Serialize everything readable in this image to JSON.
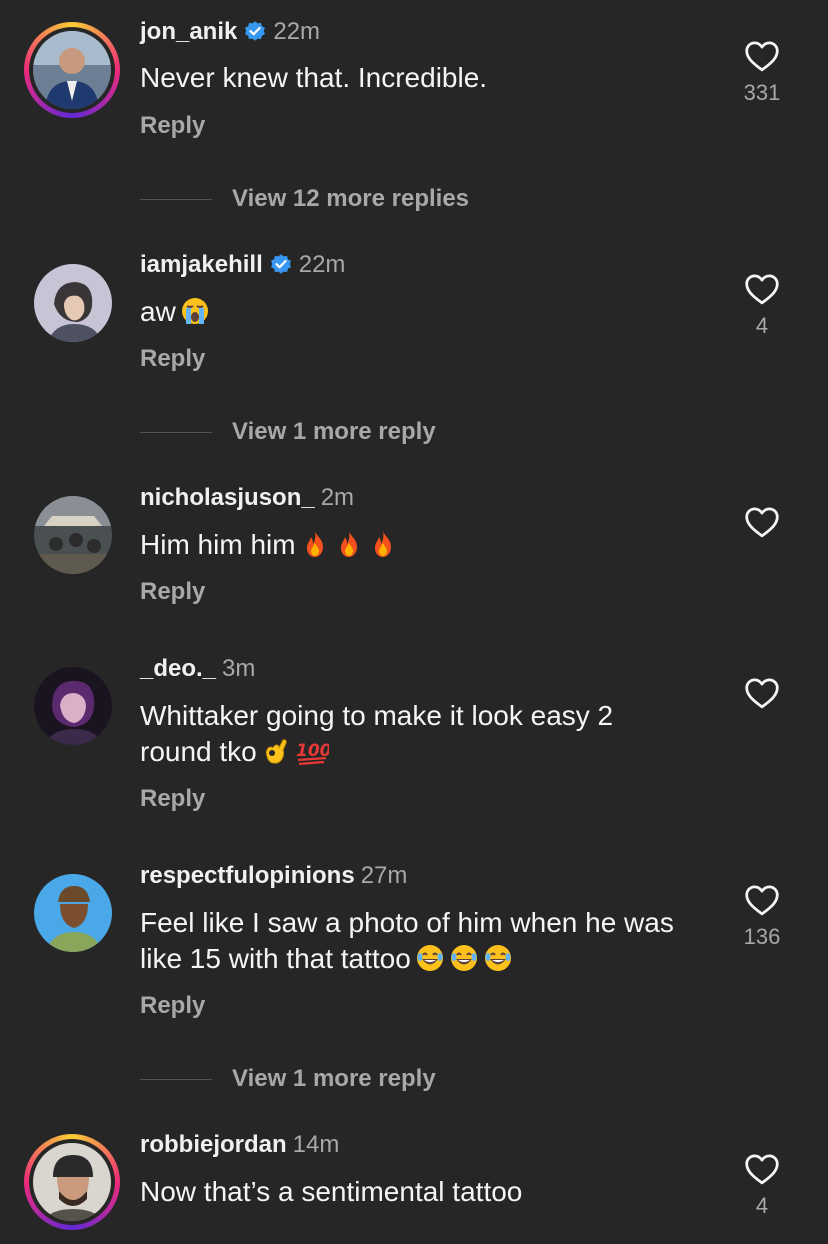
{
  "comments": [
    {
      "username": "jon_anik",
      "time": "22m",
      "text": "Never knew that. Incredible.",
      "reply": "Reply",
      "likes": "331",
      "verified": true
    },
    {
      "username": "iamjakehill",
      "time": "22m",
      "text": "aw",
      "reply": "Reply",
      "likes": "4",
      "verified": true
    },
    {
      "username": "nicholasjuson_",
      "time": "2m",
      "text": "Him him him",
      "reply": "Reply",
      "likes": ""
    },
    {
      "username": "_deo._",
      "time": "3m",
      "text_line1": "Whittaker going to make it look easy 2",
      "text_line2": "round tko",
      "reply": "Reply",
      "likes": ""
    },
    {
      "username": "respectfulopinions",
      "time": "27m",
      "text_line1": "Feel like I saw a photo of him when he was",
      "text_line2": "like 15 with that tattoo",
      "reply": "Reply",
      "likes": "136"
    },
    {
      "username": "robbiejordan",
      "time": "14m",
      "text": "Now that’s a sentimental tattoo",
      "likes": "4"
    }
  ],
  "more_replies": {
    "first": "View 12 more replies",
    "second": "View 1 more reply",
    "third": "View 1 more reply"
  },
  "colors": {
    "background": "#262626",
    "verified": "#3897f0",
    "secondary": "#a8a8a8"
  }
}
